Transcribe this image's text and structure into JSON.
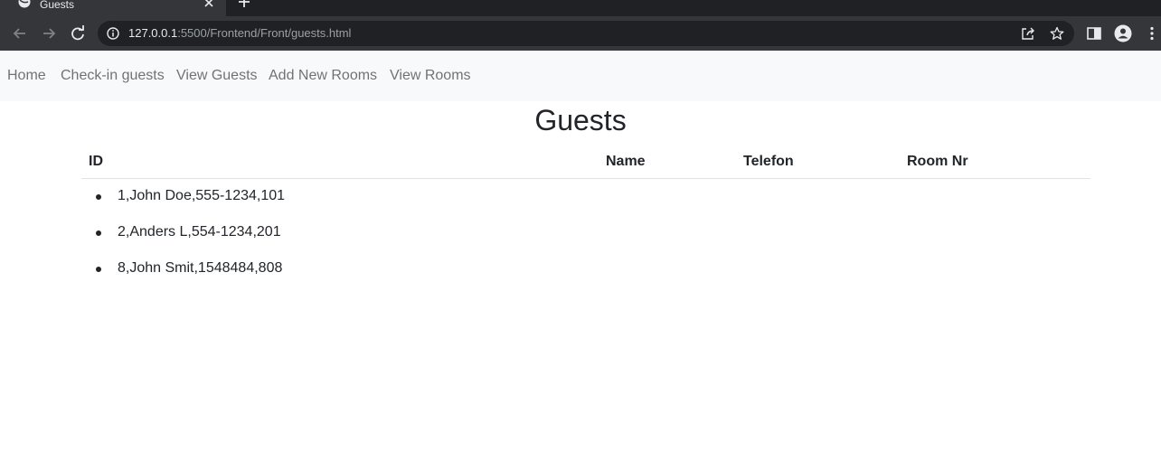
{
  "browser": {
    "tab_title": "Guests",
    "url_host": "127.0.0.1",
    "url_path": ":5500/Frontend/Front/guests.html"
  },
  "navbar": {
    "links": [
      "Home",
      "Check-in guests",
      "View Guests",
      "Add New Rooms",
      "View Rooms"
    ]
  },
  "page": {
    "title": "Guests",
    "columns": [
      "ID",
      "Name",
      "Telefon",
      "Room Nr"
    ],
    "guests": [
      "1,John Doe,555-1234,101",
      "2,Anders L,554-1234,201",
      "8,John Smit,1548484,808"
    ]
  },
  "colors": {
    "chrome_dark": "#202124",
    "chrome_toolbar": "#35363a",
    "navbar_bg": "#f8f9fa",
    "nav_link": "#6c757d",
    "text": "#212529"
  },
  "icons": [
    "globe-icon",
    "close-icon",
    "plus-icon",
    "back-arrow-icon",
    "forward-arrow-icon",
    "reload-icon",
    "info-icon",
    "share-icon",
    "star-icon",
    "sidebar-icon",
    "profile-icon",
    "more-vert-icon"
  ]
}
